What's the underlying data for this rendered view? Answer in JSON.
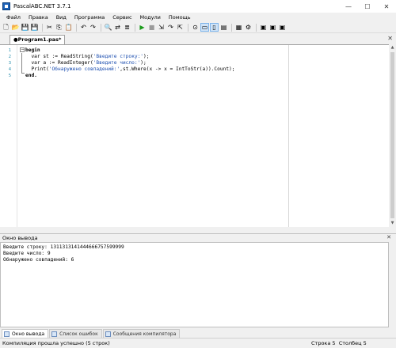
{
  "window": {
    "title": "PascalABC.NET 3.7.1"
  },
  "window_controls": {
    "minimize": "—",
    "maximize": "☐",
    "close": "✕"
  },
  "menu": [
    "Файл",
    "Правка",
    "Вид",
    "Программа",
    "Сервис",
    "Модули",
    "Помощь"
  ],
  "toolbar": [
    {
      "icon": "new-file-icon",
      "glyph": "🗋"
    },
    {
      "icon": "open-folder-icon",
      "glyph": "📂"
    },
    {
      "icon": "save-icon",
      "glyph": "💾"
    },
    {
      "icon": "save-all-icon",
      "glyph": "💾"
    },
    {
      "sep": true
    },
    {
      "icon": "cut-icon",
      "glyph": "✂"
    },
    {
      "icon": "copy-icon",
      "glyph": "⎘"
    },
    {
      "icon": "paste-icon",
      "glyph": "📋"
    },
    {
      "sep": true
    },
    {
      "icon": "undo-icon",
      "glyph": "↶"
    },
    {
      "icon": "redo-icon",
      "glyph": "↷"
    },
    {
      "sep": true
    },
    {
      "icon": "search-icon",
      "glyph": "🔍"
    },
    {
      "icon": "replace-icon",
      "glyph": "⇄"
    },
    {
      "icon": "format-code-icon",
      "glyph": "≣"
    },
    {
      "sep": true
    },
    {
      "icon": "run-icon",
      "glyph": "▶",
      "color": "#1a9b1a"
    },
    {
      "icon": "stop-icon",
      "glyph": "■",
      "color": "#9a9a9a"
    },
    {
      "icon": "step-into-icon",
      "glyph": "⇲"
    },
    {
      "icon": "step-over-icon",
      "glyph": "↷"
    },
    {
      "icon": "step-out-icon",
      "glyph": "⇱"
    },
    {
      "sep": true
    },
    {
      "icon": "breakpoint-icon",
      "glyph": "⊙"
    },
    {
      "icon": "view-split-horizontal-icon",
      "glyph": "▭",
      "active": true
    },
    {
      "icon": "view-split-vertical-icon",
      "glyph": "▯",
      "active": true
    },
    {
      "icon": "output-window-icon",
      "glyph": "▤"
    },
    {
      "sep": true
    },
    {
      "icon": "form-designer-icon",
      "glyph": "▦"
    },
    {
      "icon": "settings-icon",
      "glyph": "⚙"
    },
    {
      "sep": true
    },
    {
      "icon": "window-a-icon",
      "glyph": "▣"
    },
    {
      "icon": "window-b-icon",
      "glyph": "▣"
    },
    {
      "icon": "window-c-icon",
      "glyph": "▣"
    }
  ],
  "tab": {
    "label": "●Program1.pas*",
    "close": "✕"
  },
  "editor": {
    "lines": [
      {
        "num": "1",
        "parts": [
          {
            "t": "begin",
            "c": "kw"
          }
        ]
      },
      {
        "num": "2",
        "parts": [
          {
            "t": "  var st := ReadString("
          },
          {
            "t": "'Введите строку:'",
            "c": "str"
          },
          {
            "t": ");"
          }
        ]
      },
      {
        "num": "3",
        "parts": [
          {
            "t": "  var a := ReadInteger("
          },
          {
            "t": "'Введите число:'",
            "c": "str"
          },
          {
            "t": ");"
          }
        ]
      },
      {
        "num": "4",
        "parts": [
          {
            "t": "  Print("
          },
          {
            "t": "'Обнаружено совпадений:'",
            "c": "str"
          },
          {
            "t": ",st.Where(x -> x = IntToStr(a)).Count);"
          }
        ]
      },
      {
        "num": "5",
        "parts": [
          {
            "t": "end.",
            "c": "kw"
          }
        ]
      }
    ]
  },
  "output_pane": {
    "title": "Окно вывода",
    "close": "✕",
    "lines": [
      "Введите строку: 1311313141444666757599999",
      "Введите число: 9",
      "Обнаружено совпадений: 6"
    ]
  },
  "bottom_tabs": [
    {
      "label": "Окно вывода",
      "active": true
    },
    {
      "label": "Список ошибок",
      "active": false
    },
    {
      "label": "Сообщения компилятора",
      "active": false
    }
  ],
  "status": {
    "message": "Компиляция прошла успешно (5 строк)",
    "row_label": "Строка",
    "row": "5",
    "col_label": "Столбец",
    "col": "5"
  }
}
